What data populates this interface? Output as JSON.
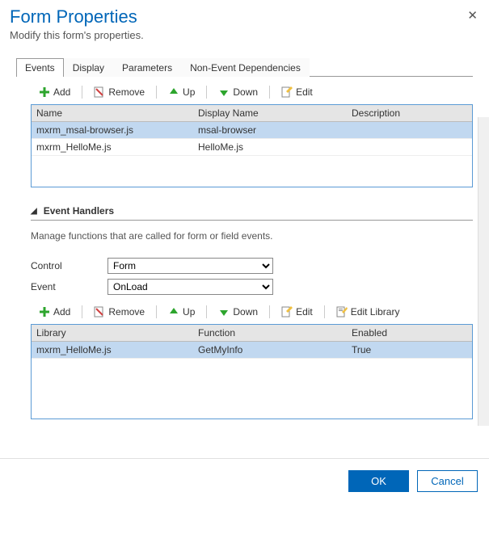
{
  "header": {
    "title": "Form Properties",
    "subtitle": "Modify this form's properties."
  },
  "tabs": {
    "items": [
      {
        "label": "Events"
      },
      {
        "label": "Display"
      },
      {
        "label": "Parameters"
      },
      {
        "label": "Non-Event Dependencies"
      }
    ]
  },
  "libs_toolbar": {
    "add": "Add",
    "remove": "Remove",
    "up": "Up",
    "down": "Down",
    "edit": "Edit"
  },
  "libs_grid": {
    "headers": {
      "name": "Name",
      "display": "Display Name",
      "desc": "Description"
    },
    "rows": [
      {
        "name": "mxrm_msal-browser.js",
        "display": "msal-browser",
        "desc": ""
      },
      {
        "name": "mxrm_HelloMe.js",
        "display": "HelloMe.js",
        "desc": ""
      }
    ]
  },
  "handlers_section": {
    "title": "Event Handlers",
    "desc": "Manage functions that are called for form or field events.",
    "control_label": "Control",
    "control_value": "Form",
    "event_label": "Event",
    "event_value": "OnLoad"
  },
  "handlers_toolbar": {
    "add": "Add",
    "remove": "Remove",
    "up": "Up",
    "down": "Down",
    "edit": "Edit",
    "edit_lib": "Edit Library"
  },
  "handlers_grid": {
    "headers": {
      "lib": "Library",
      "func": "Function",
      "enabled": "Enabled"
    },
    "rows": [
      {
        "lib": "mxrm_HelloMe.js",
        "func": "GetMyInfo",
        "enabled": "True"
      }
    ]
  },
  "footer": {
    "ok": "OK",
    "cancel": "Cancel"
  },
  "icons": {
    "add_color": "#2da52d",
    "remove_color": "#d04040",
    "up_color": "#2da52d",
    "down_color": "#2da52d"
  }
}
